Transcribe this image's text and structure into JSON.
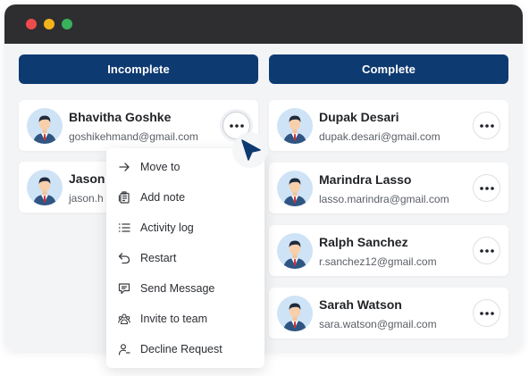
{
  "window": {
    "controls": [
      "close",
      "minimize",
      "maximize"
    ],
    "colors": {
      "close": "#ef4b4b",
      "minimize": "#f2b41c",
      "maximize": "#38b25b"
    }
  },
  "columns": {
    "incomplete": {
      "title": "Incomplete",
      "cards": [
        {
          "name": "Bhavitha Goshke",
          "email": "goshikehmand@gmail.com"
        },
        {
          "name": "Jason",
          "email": "jason.h"
        }
      ]
    },
    "complete": {
      "title": "Complete",
      "cards": [
        {
          "name": "Dupak Desari",
          "email": "dupak.desari@gmail.com"
        },
        {
          "name": "Marindra Lasso",
          "email": "lasso.marindra@gmail.com"
        },
        {
          "name": "Ralph Sanchez",
          "email": "r.sanchez12@gmail.com"
        },
        {
          "name": "Sarah Watson",
          "email": "sara.watson@gmail.com"
        }
      ]
    }
  },
  "context_menu": {
    "items": [
      {
        "label": "Move to",
        "icon": "arrow-right-icon"
      },
      {
        "label": "Add note",
        "icon": "note-icon"
      },
      {
        "label": "Activity log",
        "icon": "list-icon"
      },
      {
        "label": "Restart",
        "icon": "undo-icon"
      },
      {
        "label": "Send Message",
        "icon": "message-icon"
      },
      {
        "label": "Invite to team",
        "icon": "team-icon"
      },
      {
        "label": "Decline Request",
        "icon": "user-minus-icon"
      }
    ]
  },
  "theme": {
    "header_color": "#0e3a72",
    "background": "#f3f4f6"
  }
}
